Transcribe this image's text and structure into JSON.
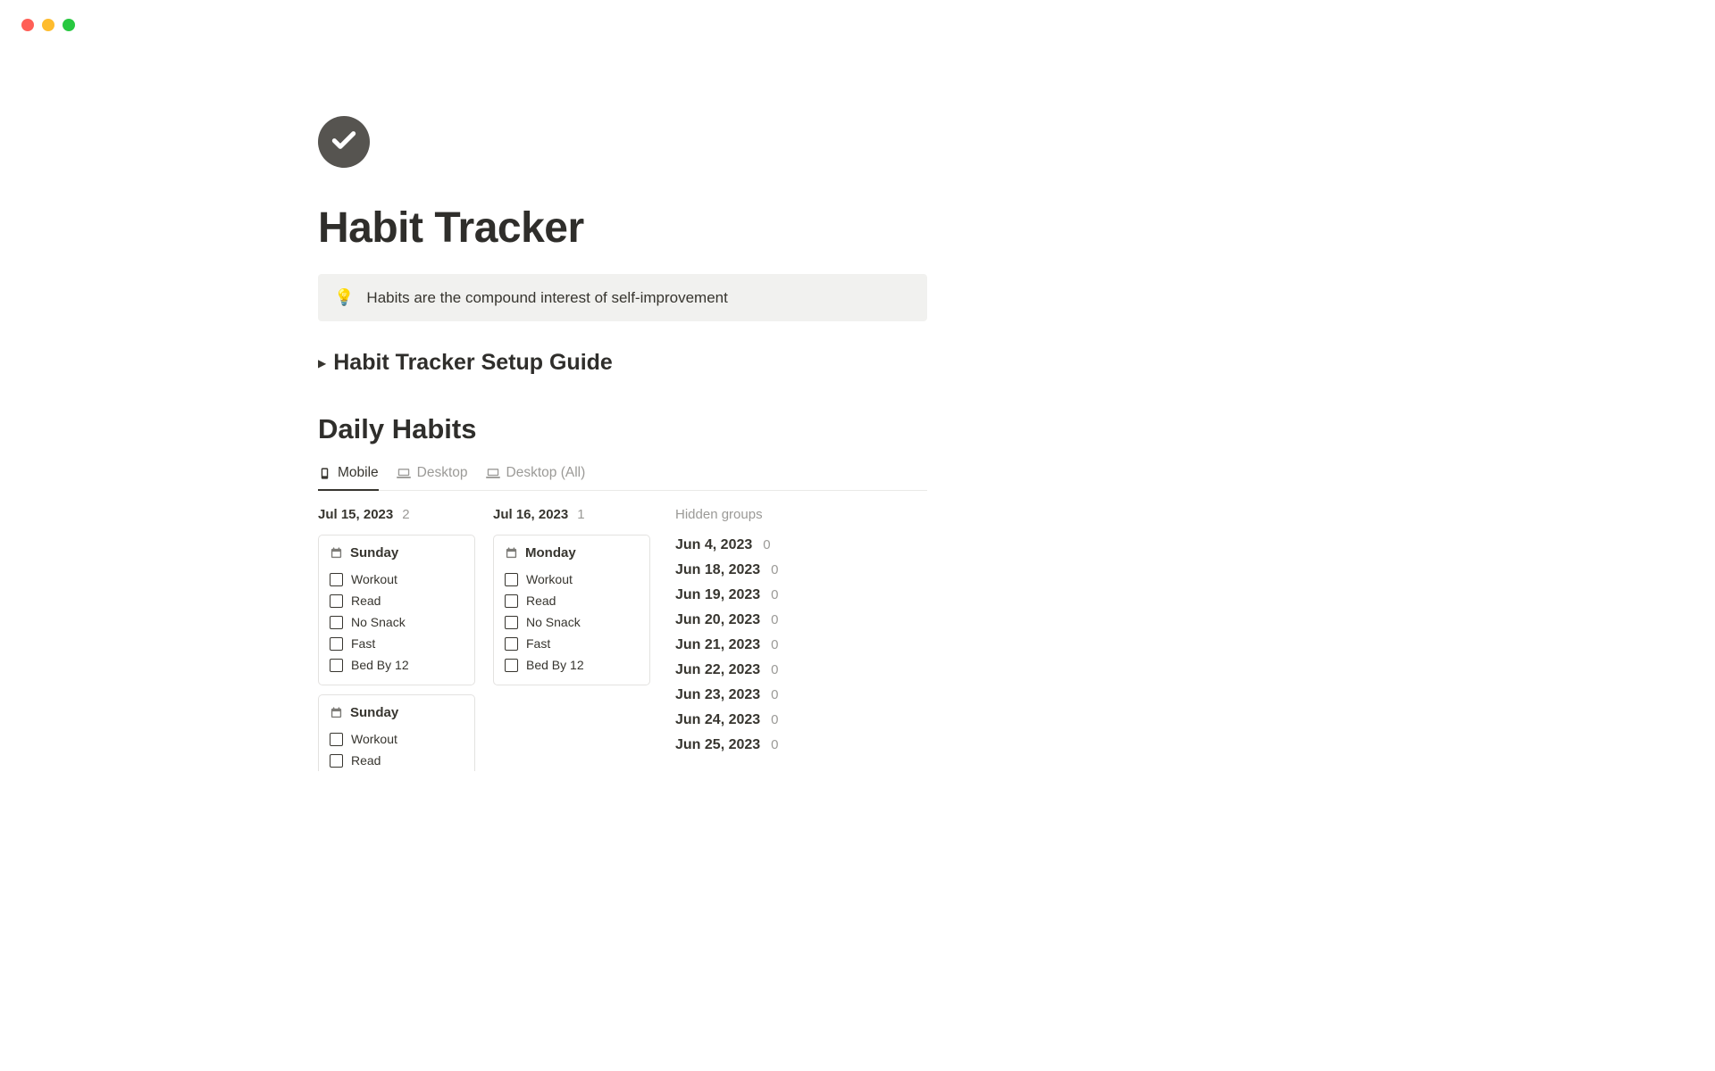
{
  "page": {
    "title": "Habit Tracker"
  },
  "callout": {
    "icon": "💡",
    "text": "Habits are the compound interest of self-improvement"
  },
  "toggle": {
    "label": "Habit Tracker Setup Guide"
  },
  "section": {
    "heading": "Daily Habits"
  },
  "tabs": [
    {
      "label": "Mobile",
      "active": true
    },
    {
      "label": "Desktop",
      "active": false
    },
    {
      "label": "Desktop (All)",
      "active": false
    }
  ],
  "columns": [
    {
      "date": "Jul 15, 2023",
      "count": "2",
      "cards": [
        {
          "title": "Sunday",
          "habits": [
            "Workout",
            "Read",
            "No Snack",
            "Fast",
            "Bed By 12"
          ]
        },
        {
          "title": "Sunday",
          "habits": [
            "Workout",
            "Read"
          ],
          "partial": true
        }
      ]
    },
    {
      "date": "Jul 16, 2023",
      "count": "1",
      "cards": [
        {
          "title": "Monday",
          "habits": [
            "Workout",
            "Read",
            "No Snack",
            "Fast",
            "Bed By 12"
          ]
        }
      ]
    }
  ],
  "hidden": {
    "title": "Hidden groups",
    "rows": [
      {
        "date": "Jun 4, 2023",
        "count": "0"
      },
      {
        "date": "Jun 18, 2023",
        "count": "0"
      },
      {
        "date": "Jun 19, 2023",
        "count": "0"
      },
      {
        "date": "Jun 20, 2023",
        "count": "0"
      },
      {
        "date": "Jun 21, 2023",
        "count": "0"
      },
      {
        "date": "Jun 22, 2023",
        "count": "0"
      },
      {
        "date": "Jun 23, 2023",
        "count": "0"
      },
      {
        "date": "Jun 24, 2023",
        "count": "0"
      },
      {
        "date": "Jun 25, 2023",
        "count": "0"
      }
    ]
  }
}
